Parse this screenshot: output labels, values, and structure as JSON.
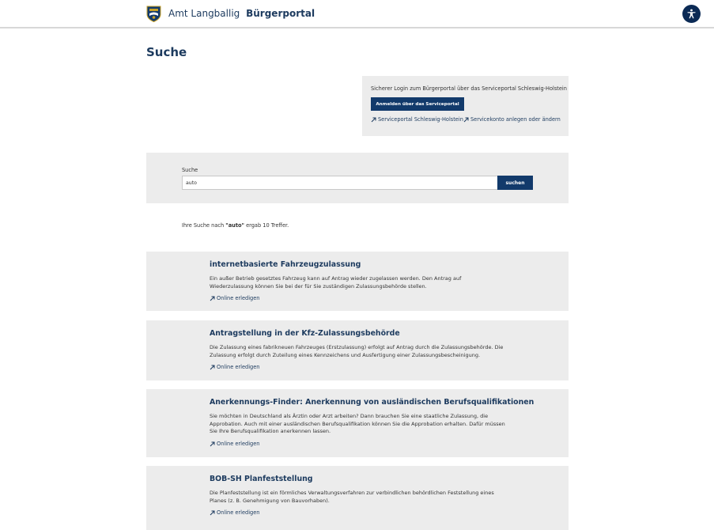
{
  "header": {
    "municipality": "Amt Langballig",
    "portal_name": "Bürgerportal",
    "logo_icon": "coat-of-arms-icon",
    "accessibility_icon": "accessibility-icon",
    "accent_color": "#123a6b"
  },
  "page": {
    "title": "Suche"
  },
  "login": {
    "text": "Sicherer Login zum Bürgerportal über das Serviceportal Schleswig-Holstein",
    "button_label": "Anmelden über das Serviceportal",
    "links": [
      {
        "label": "Serviceportal Schleswig-Holstein",
        "icon": "external-link-icon"
      },
      {
        "label": "Servicekonto anlegen oder ändern",
        "icon": "external-link-icon"
      }
    ]
  },
  "search": {
    "label": "Suche",
    "value": "auto",
    "button_label": "suchen"
  },
  "result_summary": {
    "prefix": "Ihre Suche nach ",
    "query": "\"auto\"",
    "suffix": " ergab 10 Treffer."
  },
  "results": [
    {
      "title": "internetbasierte Fahrzeugzulassung",
      "description": "Ein außer Betrieb gesetztes Fahrzeug kann auf Antrag wieder zugelassen werden. Den Antrag auf Wiederzulassung können Sie bei der für Sie zuständigen Zulassungsbehörde stellen.",
      "link_label": "Online erledigen"
    },
    {
      "title": "Antragstellung in der Kfz-Zulassungsbehörde",
      "description": "Die Zulassung eines fabrikneuen Fahrzeuges (Erstzulassung) erfolgt auf Antrag durch die Zulassungsbehörde. Die Zulassung erfolgt durch Zuteilung eines Kennzeichens und Ausfertigung einer Zulassungsbescheinigung.",
      "link_label": "Online erledigen"
    },
    {
      "title": "Anerkennungs-Finder: Anerkennung von ausländischen Berufsqualifikationen",
      "description": "Sie möchten in Deutschland als Ärztin oder Arzt arbeiten? Dann brauchen Sie eine staatliche Zulassung, die Approbation. Auch mit einer ausländischen Berufsqualifikation können Sie die Approbation erhalten. Dafür müssen Sie Ihre Berufsqualifikation anerkennen lassen.",
      "link_label": "Online erledigen"
    },
    {
      "title": "BOB-SH Planfeststellung",
      "description": "Die Planfeststellung ist ein förmliches Verwaltungsverfahren zur verbindlichen behördlichen Feststellung eines Planes (z. B. Genehmigung von Bauvorhaben).",
      "link_label": "Online erledigen"
    }
  ]
}
